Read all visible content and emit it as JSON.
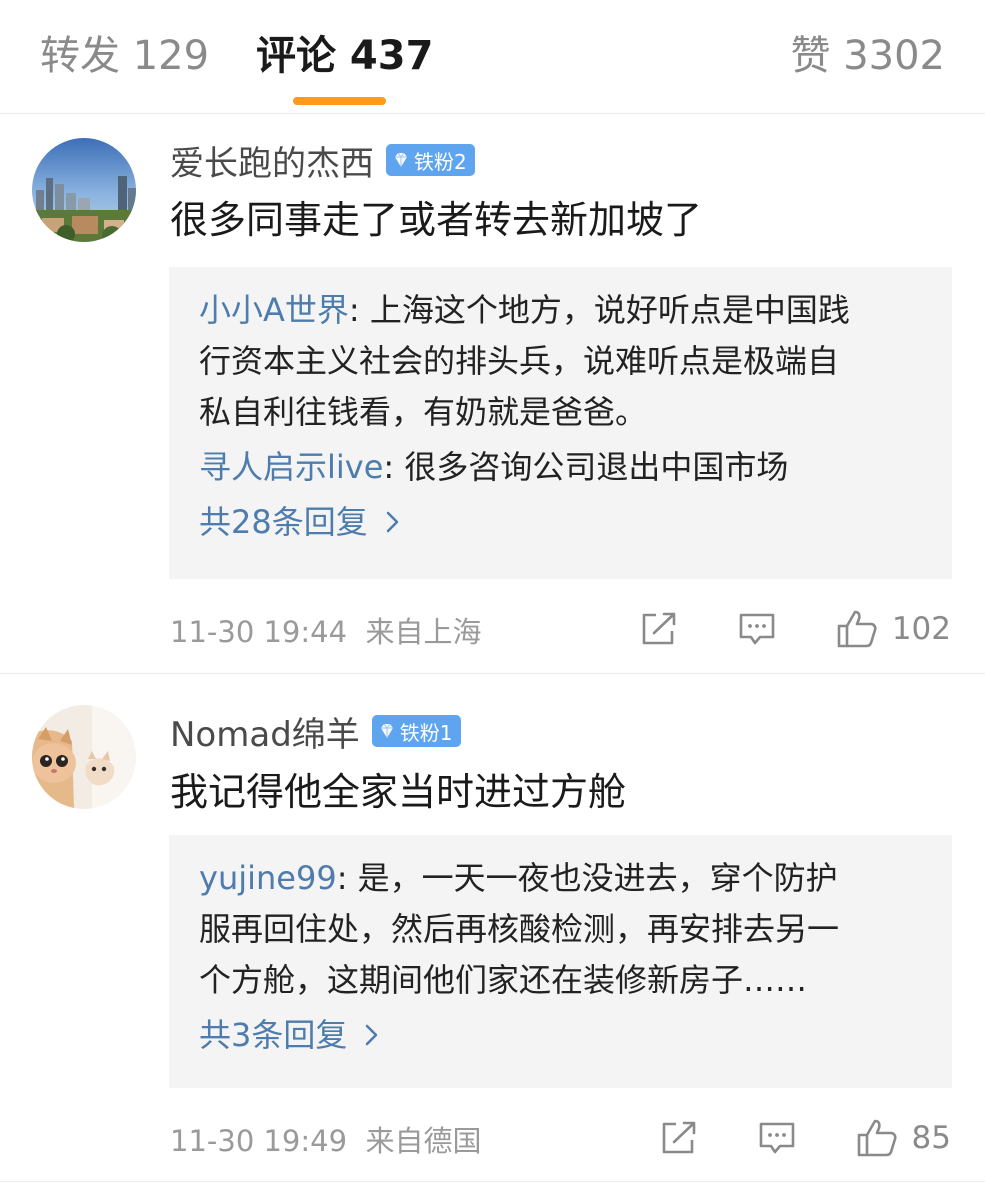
{
  "tabs": {
    "repost": "转发 129",
    "comments": "评论 437",
    "likes": "赞 3302",
    "active_color": "#ff9a1f"
  },
  "comments": [
    {
      "author": "爱长跑的杰西",
      "badge": "铁粉2",
      "text": "很多同事走了或者转去新加坡了",
      "replies": [
        {
          "user": "小小A世界",
          "sep": ": ",
          "lines": [
            "上海这个地方，说好听点是中国践",
            "行资本主义社会的排头兵，说难听点是极端自",
            "私自利往钱看，有奶就是爸爸。"
          ]
        },
        {
          "user": "寻人启示live",
          "sep": ": ",
          "lines": [
            "很多咨询公司退出中国市场"
          ]
        }
      ],
      "more_replies": "共28条回复",
      "time": "11-30 19:44",
      "location": "来自上海",
      "like_count": "102",
      "avatar_icon": "city-avatar"
    },
    {
      "author": "Nomad绵羊",
      "badge": "铁粉1",
      "text": "我记得他全家当时进过方舱",
      "replies": [
        {
          "user": "yujine99",
          "sep": ": ",
          "lines": [
            "是，一天一夜也没进去，穿个防护",
            "服再回住处，然后再核酸检测，再安排去另一",
            "个方舱，这期间他们家还在装修新房子……"
          ]
        }
      ],
      "more_replies": "共3条回复",
      "time": "11-30 19:49",
      "location": "来自德国",
      "like_count": "85",
      "avatar_icon": "cat-avatar"
    }
  ],
  "colors": {
    "link": "#4d7cad",
    "badge": "#5fa4ee",
    "muted": "#9a9a9a"
  }
}
